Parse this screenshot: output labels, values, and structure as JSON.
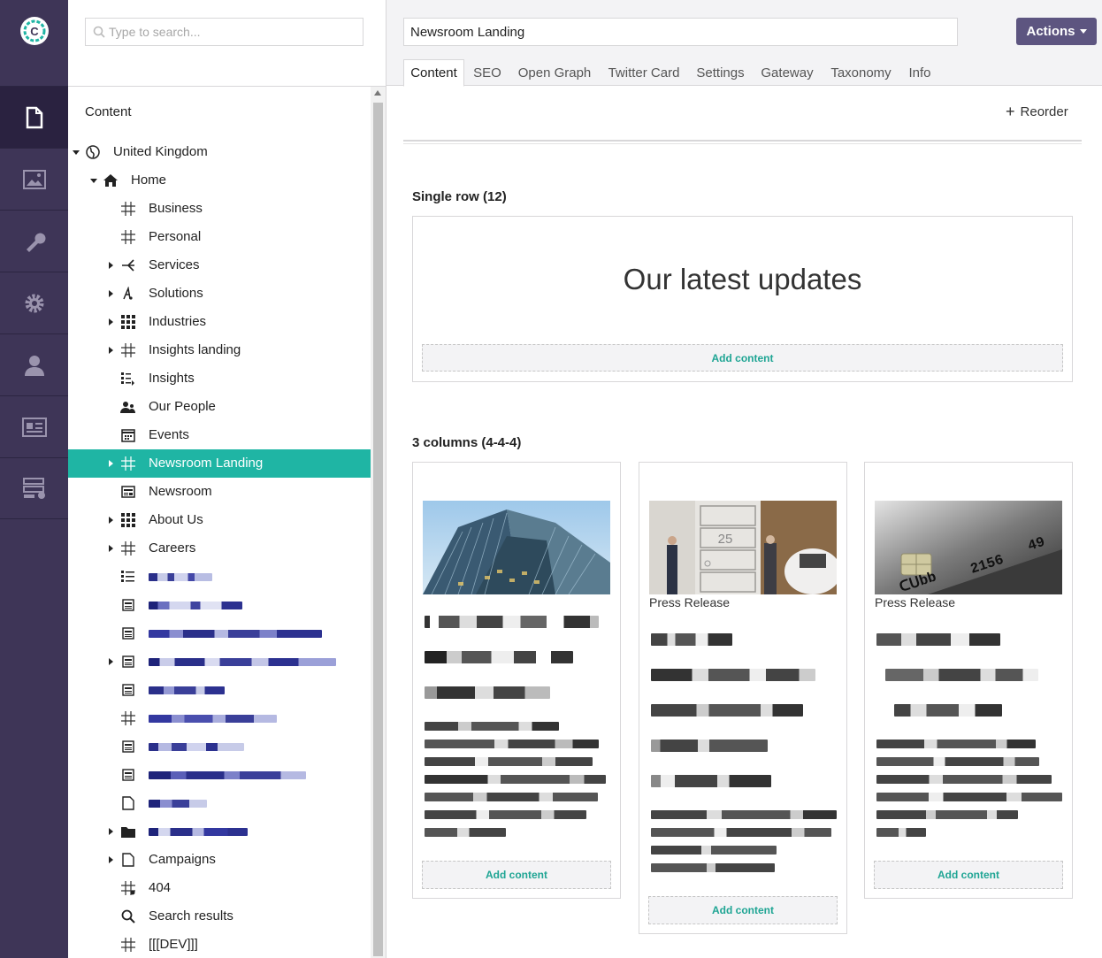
{
  "rail": {
    "sections": [
      {
        "icon": "document-icon",
        "active": true
      },
      {
        "icon": "image-icon"
      },
      {
        "icon": "wrench-icon"
      },
      {
        "icon": "gear-icon"
      },
      {
        "icon": "user-icon"
      },
      {
        "icon": "id-card-icon"
      },
      {
        "icon": "forms-icon"
      }
    ]
  },
  "tree": {
    "search_placeholder": "Type to search...",
    "heading": "Content",
    "nodes": [
      {
        "label": "United Kingdom",
        "icon": "globe-icon"
      },
      {
        "label": "Home",
        "icon": "home-icon"
      },
      {
        "label": "Business",
        "icon": "grid-hash-icon"
      },
      {
        "label": "Personal",
        "icon": "grid-hash-icon"
      },
      {
        "label": "Services",
        "icon": "split-icon"
      },
      {
        "label": "Solutions",
        "icon": "graph-icon"
      },
      {
        "label": "Industries",
        "icon": "grid-squares-icon"
      },
      {
        "label": "Insights landing",
        "icon": "grid-hash-icon"
      },
      {
        "label": "Insights",
        "icon": "list-icon"
      },
      {
        "label": "Our People",
        "icon": "people-icon"
      },
      {
        "label": "Events",
        "icon": "calendar-icon"
      },
      {
        "label": "Newsroom Landing",
        "icon": "grid-hash-icon",
        "selected": true
      },
      {
        "label": "Newsroom",
        "icon": "newspaper-icon"
      },
      {
        "label": "About Us",
        "icon": "grid-squares-icon"
      },
      {
        "label": "Careers",
        "icon": "grid-hash-icon"
      },
      {
        "label": "Campaigns",
        "icon": "document-icon"
      },
      {
        "label": "404",
        "icon": "grid-hash-icon"
      },
      {
        "label": "Search results",
        "icon": "search-icon"
      },
      {
        "label": "[[[DEV]]]",
        "icon": "grid-hash-icon"
      }
    ]
  },
  "editor": {
    "name": "Newsroom Landing",
    "actions_label": "Actions",
    "tabs": [
      "Content",
      "SEO",
      "Open Graph",
      "Twitter Card",
      "Settings",
      "Gateway",
      "Taxonomy",
      "Info"
    ],
    "active_tab": "Content",
    "reorder_label": "Reorder",
    "rows": [
      {
        "label": "Single row (12)",
        "heading": "Our latest updates",
        "add_label": "Add content"
      },
      {
        "label": "3 columns (4-4-4)",
        "add_label": "Add content"
      }
    ],
    "columns": [
      {
        "image": "building-photo",
        "tag": ""
      },
      {
        "image": "doorway-photo",
        "tag": "Press Release"
      },
      {
        "image": "card-photo",
        "tag": "Press Release"
      }
    ]
  },
  "colors": {
    "rail": "#3e3557",
    "accent": "#1fb5a4",
    "actions": "#5d5580"
  }
}
